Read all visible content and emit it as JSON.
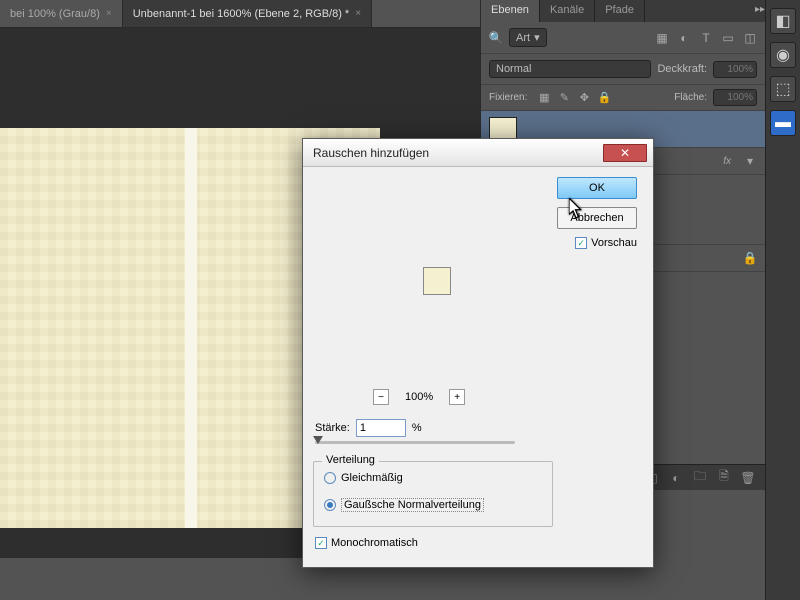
{
  "tabs": {
    "t0": "bei 100% (Grau/8)",
    "t1": "Unbenannt-1 bei 1600% (Ebene 2, RGB/8) *"
  },
  "panels": {
    "layers_tab": "Ebenen",
    "channels_tab": "Kanäle",
    "paths_tab": "Pfade",
    "kind_label": "Art",
    "blend_mode": "Normal",
    "opacity_label": "Deckkraft:",
    "opacity_value": "100%",
    "lock_label": "Fixieren:",
    "fill_label": "Fläche:",
    "fill_value": "100%",
    "fx_label": "fx"
  },
  "dialog": {
    "title": "Rauschen hinzufügen",
    "ok": "OK",
    "cancel": "Abbrechen",
    "preview": "Vorschau",
    "zoom_pct": "100%",
    "strength_label": "Stärke:",
    "strength_value": "1",
    "strength_unit": "%",
    "dist_legend": "Verteilung",
    "dist_uniform": "Gleichmäßig",
    "dist_gauss": "Gaußsche Normalverteilung",
    "mono": "Monochromatisch"
  }
}
